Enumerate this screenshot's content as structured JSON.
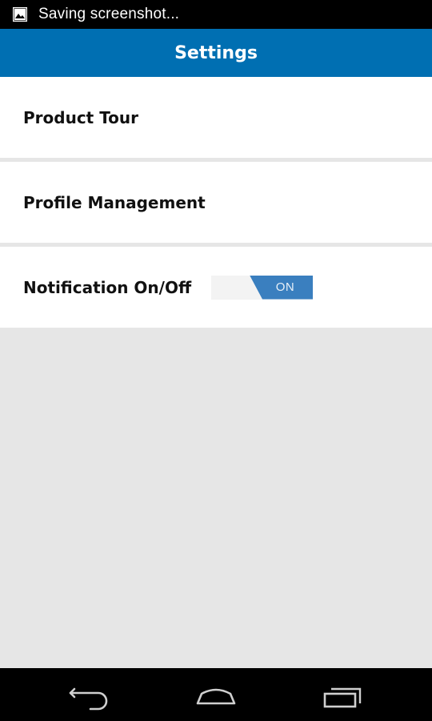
{
  "status_bar": {
    "notification_icon": "image-icon",
    "text": "Saving screenshot..."
  },
  "action_bar": {
    "title": "Settings"
  },
  "settings": {
    "items": [
      {
        "label": "Product Tour"
      },
      {
        "label": "Profile Management"
      },
      {
        "label": "Notification On/Off"
      }
    ],
    "notification_toggle": {
      "state_label": "ON",
      "on": true
    }
  },
  "nav_bar": {
    "buttons": [
      "back-icon",
      "home-icon",
      "recents-icon"
    ]
  },
  "colors": {
    "action_bar": "#006fb2",
    "toggle_on": "#3a7fbf",
    "background": "#e6e6e6"
  }
}
